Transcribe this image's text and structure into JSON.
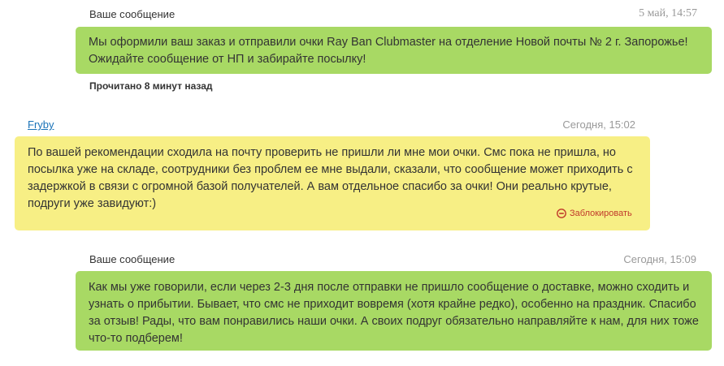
{
  "messages": [
    {
      "author": "Ваше сообщение",
      "time": "5 май, 14:57",
      "text": "Мы оформили ваш заказ и отправили очки Ray Ban Clubmaster на отделение Новой почты № 2 г. Запорожье! Ожидайте сообщение от НП и забирайте посылку!",
      "read_status": "Прочитано 8 минут назад"
    },
    {
      "author": "Fryby",
      "time": "Сегодня, 15:02",
      "text": "По вашей рекомендации сходила на почту проверить не пришли ли мне мои очки. Смс пока не пришла, но посылка уже на складе, соотрудники без проблем ее мне выдали, сказали, что сообщение может приходить с задержкой в связи с огромной базой получателей. А вам отдельное спасибо за очки! Они реально крутые, подруги уже завидуют:)",
      "action": "Заблокировать"
    },
    {
      "author": "Ваше сообщение",
      "time": "Сегодня, 15:09",
      "text": "Как мы уже говорили, если через 2-3 дня после отправки не пришло сообщение о доставке, можно сходить и узнать о прибытии. Бывает, что смс не приходит вовремя (хотя крайне редко), особенно на праздник. Спасибо за отзыв! Рады, что вам понравились наши очки. А своих подруг обязательно направляйте к нам, для них тоже что-то подберем!"
    }
  ],
  "colors": {
    "outgoing_bubble": "#a8d964",
    "incoming_bubble": "#f7ef85",
    "link": "#1a73b8",
    "block_action": "#c0392b"
  },
  "icons": {
    "block": "no-entry-icon"
  }
}
